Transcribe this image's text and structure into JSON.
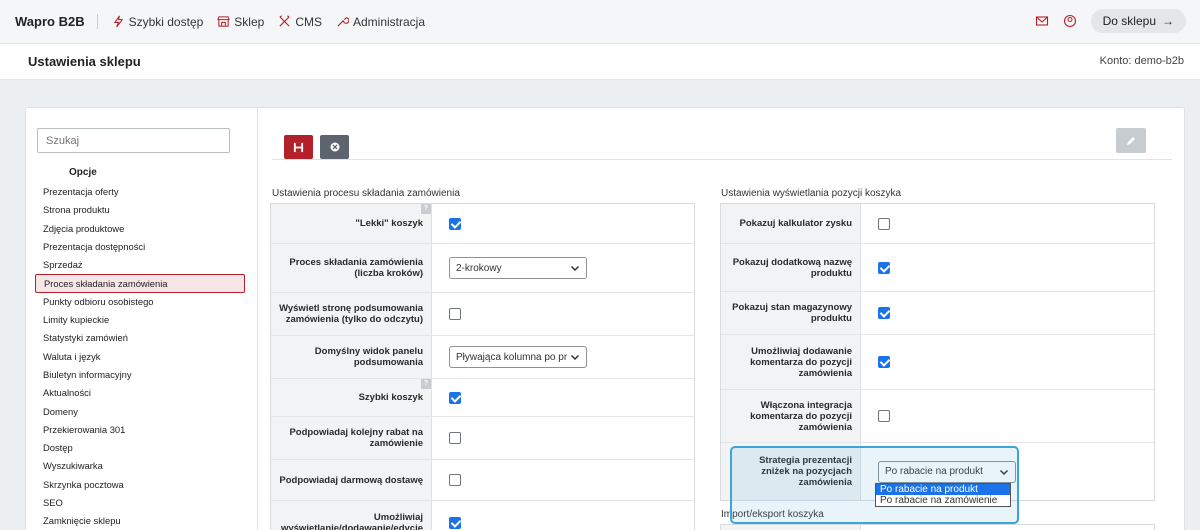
{
  "topnav": {
    "brand": "Wapro B2B",
    "items": [
      {
        "label": "Szybki dostęp",
        "icon": "lightning-icon"
      },
      {
        "label": "Sklep",
        "icon": "store-icon"
      },
      {
        "label": "CMS",
        "icon": "tools-icon"
      },
      {
        "label": "Administracja",
        "icon": "wrench-icon"
      }
    ],
    "shop_button": "Do sklepu"
  },
  "header": {
    "title": "Ustawienia sklepu",
    "account": "Konto: demo-b2b"
  },
  "sidebar": {
    "search_placeholder": "Szukaj",
    "group_label": "Opcje",
    "items": [
      "Prezentacja oferty",
      "Strona produktu",
      "Zdjęcia produktowe",
      "Prezentacja dostępności",
      "Sprzedaż",
      "Proces składania zamówienia",
      "Punkty odbioru osobistego",
      "Limity kupieckie",
      "Statystyki zamówień",
      "Waluta i język",
      "Biuletyn informacyjny",
      "Aktualności",
      "Domeny",
      "Przekierowania 301",
      "Dostęp",
      "Wyszukiwarka",
      "Skrzynka pocztowa",
      "SEO",
      "Zamknięcie sklepu"
    ],
    "active_index": 5
  },
  "left_section": {
    "title": "Ustawienia procesu składania zamówienia",
    "rows": [
      {
        "label": "\"Lekki\" koszyk",
        "type": "checkbox",
        "checked": true,
        "help": true
      },
      {
        "label": "Proces składania zamówienia (liczba kroków)",
        "type": "select",
        "value": "2-krokowy"
      },
      {
        "label": "Wyświetl stronę podsumowania zamówienia (tylko do odczytu)",
        "type": "checkbox",
        "checked": false
      },
      {
        "label": "Domyślny widok panelu podsumowania",
        "type": "select",
        "value": "Pływająca kolumna po pr"
      },
      {
        "label": "Szybki koszyk",
        "type": "checkbox",
        "checked": true,
        "help": true
      },
      {
        "label": "Podpowiadaj kolejny rabat na zamówienie",
        "type": "checkbox",
        "checked": false
      },
      {
        "label": "Podpowiadaj darmową dostawę",
        "type": "checkbox",
        "checked": false
      },
      {
        "label": "Umożliwiaj wyświetlanie/dodawanie/edycję",
        "type": "checkbox",
        "checked": true
      }
    ]
  },
  "right_section": {
    "title": "Ustawienia wyświetlania pozycji koszyka",
    "rows": [
      {
        "label": "Pokazuj kalkulator zysku",
        "type": "checkbox",
        "checked": false
      },
      {
        "label": "Pokazuj dodatkową nazwę produktu",
        "type": "checkbox",
        "checked": true
      },
      {
        "label": "Pokazuj stan magazynowy produktu",
        "type": "checkbox",
        "checked": true
      },
      {
        "label": "Umożliwiaj dodawanie komentarza do pozycji zamówienia",
        "type": "checkbox",
        "checked": true
      },
      {
        "label": "Włączona integracja komentarza do pozycji zamówienia",
        "type": "checkbox",
        "checked": false
      },
      {
        "label": "Strategia prezentacji zniżek na pozycjach zamówienia",
        "type": "select",
        "value": "Po rabacie na produkt"
      }
    ],
    "dropdown_options": [
      "Po rabacie na produkt",
      "Po rabacie na zamówienie"
    ],
    "dropdown_selected": 0
  },
  "import_section": {
    "title": "Import/eksport koszyka"
  },
  "colors": {
    "accent_red": "#b3202a",
    "checkbox_blue": "#1a73e8",
    "highlight": "#3aa5d9"
  }
}
